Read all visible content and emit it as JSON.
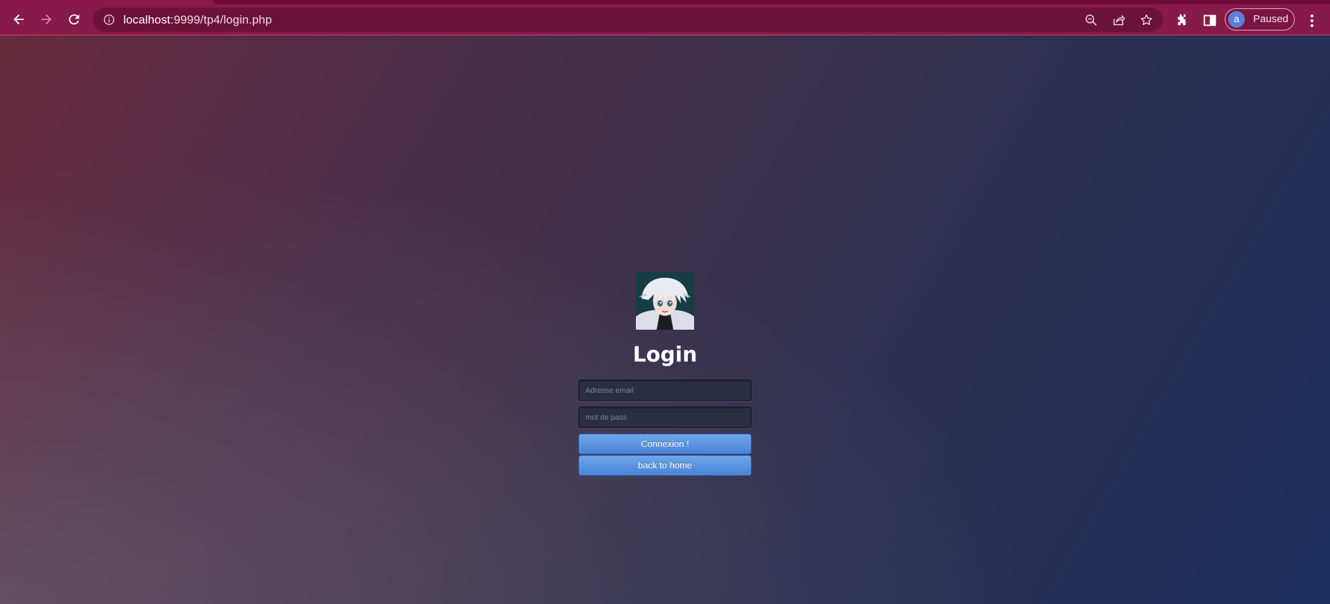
{
  "browser": {
    "url_host": "localhost",
    "url_path": ":9999/tp4/login.php",
    "profile": {
      "initial": "a",
      "status": "Paused"
    },
    "icons": [
      "back-icon",
      "forward-icon",
      "reload-icon",
      "info-icon",
      "zoom-out-icon",
      "share-icon",
      "bookmark-star-icon",
      "extensions-icon",
      "side-panel-icon",
      "menu-icon"
    ]
  },
  "login": {
    "title": "Login",
    "email_placeholder": "Adresse email",
    "password_placeholder": "mot de pass",
    "submit_label": "Connexion !",
    "home_label": "back to home"
  },
  "colors": {
    "chrome": "#861a48",
    "button": "#5a92e0"
  }
}
